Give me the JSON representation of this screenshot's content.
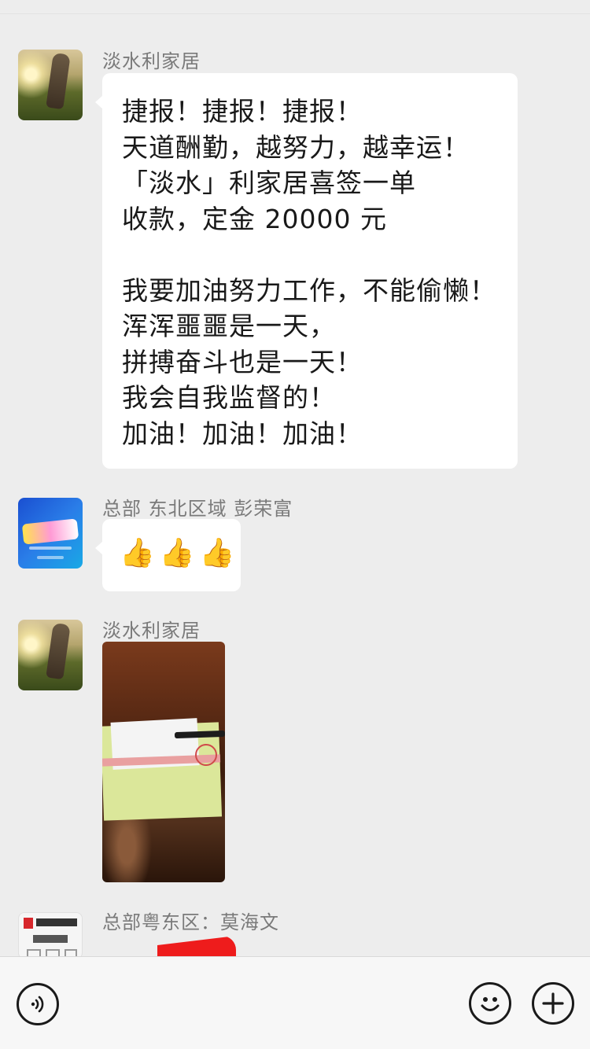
{
  "messages": [
    {
      "sender": "淡水利家居",
      "type": "text",
      "text": "捷报！捷报！捷报！\n天道酬勤，越努力，越幸运！\n「淡水」利家居喜签一单\n收款，定金 20000 元\n\n我要加油努力工作，不能偷懒！\n浑浑噩噩是一天，\n拼搏奋斗也是一天！\n我会自我监督的！\n加油！加油！加油！"
    },
    {
      "sender": "总部 东北区域 彭荣富",
      "type": "emoji",
      "emojis": [
        "👍",
        "👍",
        "👍"
      ]
    },
    {
      "sender": "淡水利家居",
      "type": "image"
    },
    {
      "sender": "总部粤东区：莫海文",
      "type": "image"
    }
  ],
  "bottom_bar": {
    "voice_icon": "voice-icon",
    "emoji_icon": "emoji-icon",
    "more_icon": "plus-icon"
  },
  "colors": {
    "background": "#ededed",
    "bubble": "#ffffff",
    "sender_text": "#7a7a7a",
    "message_text": "#191919"
  }
}
